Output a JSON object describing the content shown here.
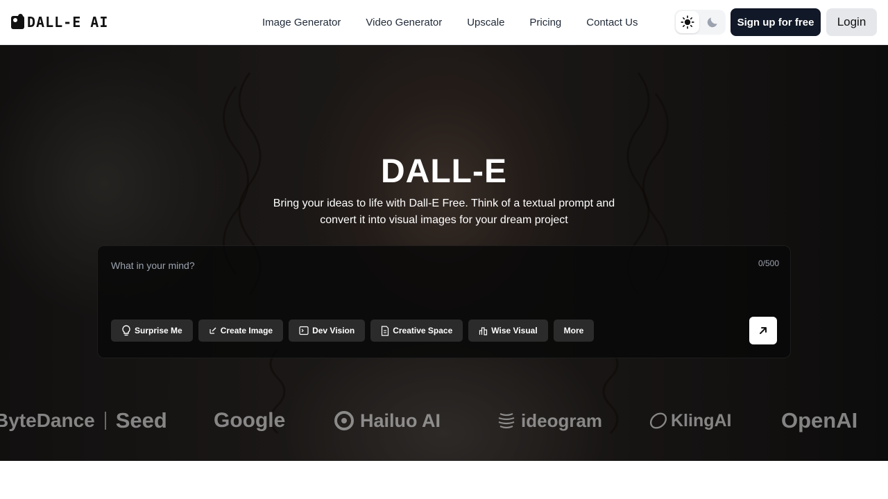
{
  "header": {
    "logo_text": "DALL-E AI",
    "nav": [
      {
        "label": "Image Generator"
      },
      {
        "label": "Video Generator"
      },
      {
        "label": "Upscale"
      },
      {
        "label": "Pricing"
      },
      {
        "label": "Contact Us"
      }
    ],
    "theme": {
      "light_icon": "sun-icon",
      "dark_icon": "moon-icon",
      "active": "light"
    },
    "signup_label": "Sign up for free",
    "login_label": "Login"
  },
  "hero": {
    "title": "DALL-E",
    "subtitle": "Bring your ideas to life with Dall-E Free. Think of a textual prompt and convert it into visual images for your dream project",
    "prompt": {
      "placeholder": "What in your mind?",
      "value": "",
      "counter": "0/500"
    },
    "chips": [
      {
        "label": "Surprise Me",
        "icon": "lightbulb-icon"
      },
      {
        "label": "Create Image",
        "icon": "edit-image-icon"
      },
      {
        "label": "Dev Vision",
        "icon": "terminal-icon"
      },
      {
        "label": "Creative Space",
        "icon": "document-icon"
      },
      {
        "label": "Wise Visual",
        "icon": "bar-chart-icon"
      },
      {
        "label": "More",
        "icon": ""
      }
    ],
    "send_icon": "arrow-up-right-icon",
    "brands": [
      {
        "label": "ByteDance",
        "suffix": "Seed"
      },
      {
        "label": "Google"
      },
      {
        "label": "Hailuo AI"
      },
      {
        "label": "ideogram"
      },
      {
        "label": "KlingAI"
      },
      {
        "label": "OpenAI"
      }
    ]
  },
  "colors": {
    "primary_button": "#111827",
    "secondary_button": "#e5e7eb",
    "prompt_bg": "#080808",
    "chip_bg": "#2b2b2b"
  }
}
